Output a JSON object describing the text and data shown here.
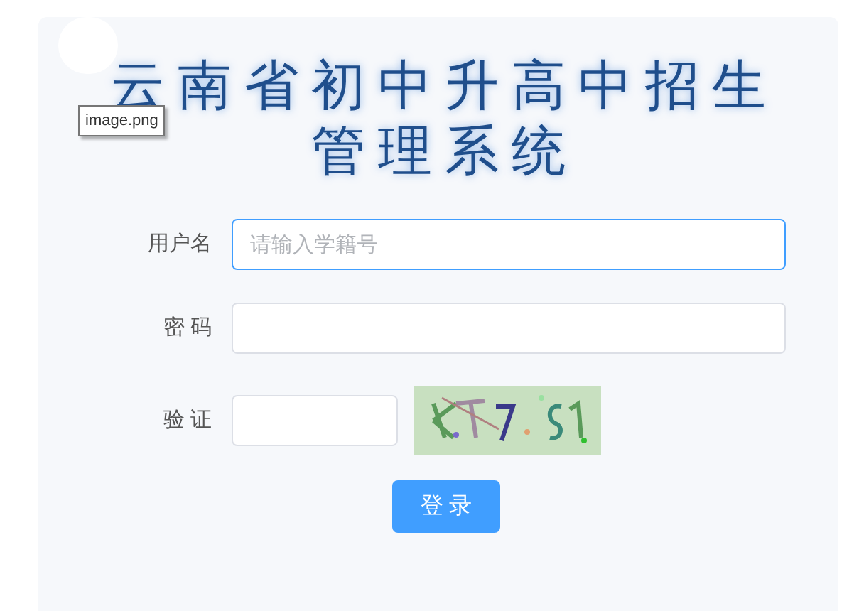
{
  "title_lines": [
    "云南省初中升高中招生",
    "管理系统"
  ],
  "tooltip": "image.png",
  "fields": [
    {
      "kind": "text",
      "label": "用户名",
      "placeholder": "请输入学籍号",
      "focused": true
    },
    {
      "kind": "password",
      "label": "密 码",
      "focused": false
    },
    {
      "kind": "captcha",
      "label": "验 证",
      "focused": false
    }
  ],
  "login_button": "登 录"
}
